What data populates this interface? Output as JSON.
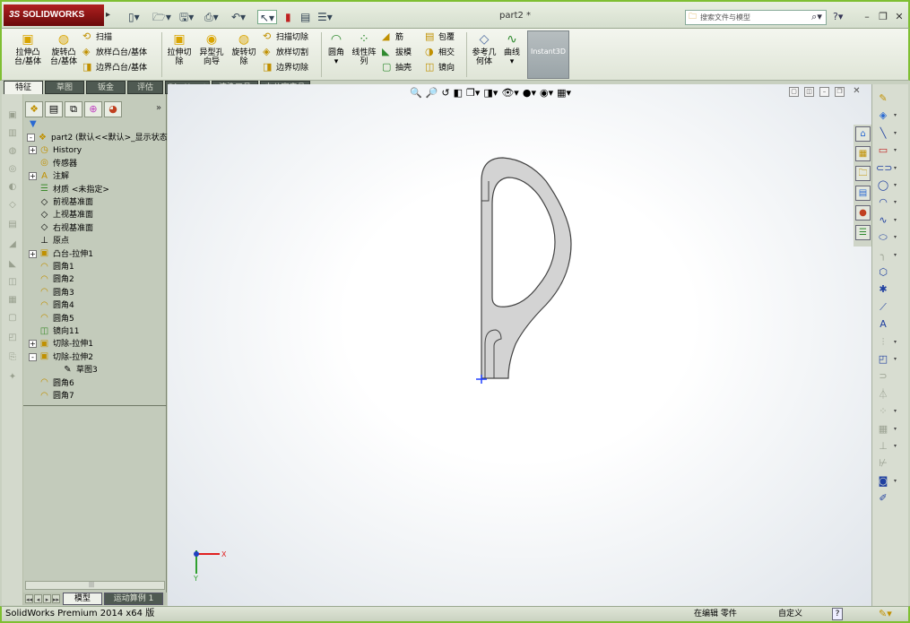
{
  "app": {
    "logo_prefix": "3S",
    "logo_text": "SOLIDWORKS",
    "document_title": "part2 *",
    "search_placeholder": "搜索文件与模型"
  },
  "quick_access": [
    {
      "icon": "new-document-icon",
      "glyph": "▯▾"
    },
    {
      "icon": "open-folder-icon",
      "glyph": "🗁▾"
    },
    {
      "icon": "save-icon",
      "glyph": "🖫▾"
    },
    {
      "icon": "print-icon",
      "glyph": "⎙▾"
    },
    {
      "icon": "undo-icon",
      "glyph": "↶▾"
    },
    {
      "icon": "select-cursor-icon",
      "glyph": "↖▾"
    },
    {
      "icon": "rebuild-icon",
      "glyph": "▮"
    },
    {
      "icon": "file-properties-icon",
      "glyph": "▤"
    },
    {
      "icon": "options-icon",
      "glyph": "☰▾"
    }
  ],
  "ribbon": {
    "big_buttons": [
      {
        "label_line1": "拉伸凸",
        "label_line2": "台/基体",
        "glyph": "▣",
        "color": "#d9a400"
      },
      {
        "label_line1": "旋转凸",
        "label_line2": "台/基体",
        "glyph": "◍",
        "color": "#d9a400"
      },
      {
        "label_line1": "拉伸切",
        "label_line2": "除",
        "glyph": "▣",
        "color": "#d9a400"
      },
      {
        "label_line1": "异型孔",
        "label_line2": "向导",
        "glyph": "◉",
        "color": "#d9a400"
      },
      {
        "label_line1": "旋转切",
        "label_line2": "除",
        "glyph": "◍",
        "color": "#d9a400"
      },
      {
        "label_line1": "圆角",
        "label_line2": "",
        "glyph": "◠",
        "color": "#2f8a2f"
      },
      {
        "label_line1": "线性阵",
        "label_line2": "列",
        "glyph": "⁘",
        "color": "#2f8a2f"
      },
      {
        "label_line1": "参考几",
        "label_line2": "何体",
        "glyph": "◇",
        "color": "#4c6aa0"
      },
      {
        "label_line1": "曲线",
        "label_line2": "",
        "glyph": "∿",
        "color": "#2f8a2f"
      }
    ],
    "small_buttons": [
      {
        "label": "扫描",
        "glyph": "⟲",
        "color": "#c09000"
      },
      {
        "label": "放样凸台/基体",
        "glyph": "◈",
        "color": "#c09000"
      },
      {
        "label": "边界凸台/基体",
        "glyph": "◨",
        "color": "#c09000"
      },
      {
        "label": "扫描切除",
        "glyph": "⟲",
        "color": "#c09000"
      },
      {
        "label": "放样切割",
        "glyph": "◈",
        "color": "#c09000"
      },
      {
        "label": "边界切除",
        "glyph": "◨",
        "color": "#c09000"
      },
      {
        "label": "筋",
        "glyph": "◢",
        "color": "#c09000"
      },
      {
        "label": "拔模",
        "glyph": "◣",
        "color": "#2f8a2f"
      },
      {
        "label": "抽壳",
        "glyph": "▢",
        "color": "#2f8a2f"
      },
      {
        "label": "包覆",
        "glyph": "▤",
        "color": "#c09000"
      },
      {
        "label": "相交",
        "glyph": "◑",
        "color": "#c09000"
      },
      {
        "label": "镜向",
        "glyph": "◫",
        "color": "#c09000"
      }
    ],
    "instant3d_label": "Instant3D"
  },
  "tabs": [
    "特征",
    "草图",
    "钣金",
    "评估",
    "DimXpert",
    "渲染工具",
    "办公室产品"
  ],
  "feature_manager": {
    "tab_icons": [
      {
        "name": "feature-tree-tab-icon",
        "glyph": "❖"
      },
      {
        "name": "property-manager-tab-icon",
        "glyph": "▤"
      },
      {
        "name": "configuration-manager-tab-icon",
        "glyph": "⧉"
      },
      {
        "name": "dimxpert-manager-tab-icon",
        "glyph": "⊕"
      },
      {
        "name": "display-manager-tab-icon",
        "glyph": "◕"
      }
    ],
    "collapse_glyph": "»",
    "filter_glyph": "▼",
    "tree": [
      {
        "label": "part2 (默认<<默认>_显示状态",
        "indent": 0,
        "expander": "-",
        "glyph": "❖",
        "tone": "yel"
      },
      {
        "label": "History",
        "indent": 1,
        "expander": "+",
        "glyph": "◷",
        "tone": "yel"
      },
      {
        "label": "传感器",
        "indent": 1,
        "expander": "",
        "glyph": "◎",
        "tone": "yel"
      },
      {
        "label": "注解",
        "indent": 1,
        "expander": "+",
        "glyph": "A",
        "tone": "yel"
      },
      {
        "label": "材质 <未指定>",
        "indent": 1,
        "expander": "",
        "glyph": "☰",
        "tone": "grn"
      },
      {
        "label": "前视基准面",
        "indent": 1,
        "expander": "",
        "glyph": "◇",
        "tone": ""
      },
      {
        "label": "上视基准面",
        "indent": 1,
        "expander": "",
        "glyph": "◇",
        "tone": ""
      },
      {
        "label": "右视基准面",
        "indent": 1,
        "expander": "",
        "glyph": "◇",
        "tone": ""
      },
      {
        "label": "原点",
        "indent": 1,
        "expander": "",
        "glyph": "⊥",
        "tone": ""
      },
      {
        "label": "凸台-拉伸1",
        "indent": 1,
        "expander": "+",
        "glyph": "▣",
        "tone": "yel"
      },
      {
        "label": "圆角1",
        "indent": 1,
        "expander": "",
        "glyph": "◠",
        "tone": "yel"
      },
      {
        "label": "圆角2",
        "indent": 1,
        "expander": "",
        "glyph": "◠",
        "tone": "yel"
      },
      {
        "label": "圆角3",
        "indent": 1,
        "expander": "",
        "glyph": "◠",
        "tone": "yel"
      },
      {
        "label": "圆角4",
        "indent": 1,
        "expander": "",
        "glyph": "◠",
        "tone": "yel"
      },
      {
        "label": "圆角5",
        "indent": 1,
        "expander": "",
        "glyph": "◠",
        "tone": "yel"
      },
      {
        "label": "镜向11",
        "indent": 1,
        "expander": "",
        "glyph": "◫",
        "tone": "grn"
      },
      {
        "label": "切除-拉伸1",
        "indent": 1,
        "expander": "+",
        "glyph": "▣",
        "tone": "yel"
      },
      {
        "label": "切除-拉伸2",
        "indent": 1,
        "expander": "-",
        "glyph": "▣",
        "tone": "yel"
      },
      {
        "label": "草图3",
        "indent": 2,
        "expander": "",
        "glyph": "✎",
        "tone": ""
      },
      {
        "label": "圆角6",
        "indent": 1,
        "expander": "",
        "glyph": "◠",
        "tone": "yel"
      },
      {
        "label": "圆角7",
        "indent": 1,
        "expander": "",
        "glyph": "◠",
        "tone": "yel"
      }
    ],
    "bottom_tabs": [
      "模型",
      "运动算例 1"
    ],
    "hscroll_glyph": "|||"
  },
  "graphics": {
    "hud_icons": [
      {
        "name": "zoom-to-fit-icon",
        "glyph": "🔍"
      },
      {
        "name": "zoom-area-icon",
        "glyph": "🔎"
      },
      {
        "name": "previous-view-icon",
        "glyph": "↺"
      },
      {
        "name": "section-view-icon",
        "glyph": "◧"
      },
      {
        "name": "view-orientation-icon",
        "glyph": "❒▾"
      },
      {
        "name": "display-style-icon",
        "glyph": "◨▾"
      },
      {
        "name": "hide-show-items-icon",
        "glyph": "👁▾"
      },
      {
        "name": "edit-appearance-icon",
        "glyph": "●▾"
      },
      {
        "name": "apply-scene-icon",
        "glyph": "◉▾"
      },
      {
        "name": "view-settings-icon",
        "glyph": "▦▾"
      }
    ],
    "triad_labels": {
      "x": "X",
      "y": "Y"
    }
  },
  "task_pane": [
    {
      "name": "solidworks-resources-icon",
      "glyph": "⌂"
    },
    {
      "name": "design-library-icon",
      "glyph": "▦"
    },
    {
      "name": "file-explorer-icon",
      "glyph": "🗀"
    },
    {
      "name": "view-palette-icon",
      "glyph": "▤"
    },
    {
      "name": "appearances-scenes-icon",
      "glyph": "●"
    },
    {
      "name": "custom-properties-icon",
      "glyph": "☰"
    }
  ],
  "right_toolbar": [
    {
      "name": "exit-sketch-icon",
      "glyph": "✎",
      "dim": false,
      "arrow": false
    },
    {
      "name": "smart-dimension-icon",
      "glyph": "◈",
      "dim": false,
      "arrow": true
    },
    {
      "name": "line-tool-icon",
      "glyph": "╲",
      "dim": false,
      "arrow": true
    },
    {
      "name": "rectangle-tool-icon",
      "glyph": "▭",
      "dim": false,
      "arrow": true
    },
    {
      "name": "slot-tool-icon",
      "glyph": "⊂⊃",
      "dim": false,
      "arrow": true
    },
    {
      "name": "circle-tool-icon",
      "glyph": "◯",
      "dim": false,
      "arrow": true
    },
    {
      "name": "arc-tool-icon",
      "glyph": "◠",
      "dim": false,
      "arrow": true
    },
    {
      "name": "spline-tool-icon",
      "glyph": "∿",
      "dim": false,
      "arrow": true
    },
    {
      "name": "ellipse-tool-icon",
      "glyph": "⬭",
      "dim": false,
      "arrow": true
    },
    {
      "name": "fillet-sketch-icon",
      "glyph": "╮",
      "dim": true,
      "arrow": true
    },
    {
      "name": "polygon-tool-icon",
      "glyph": "⬡",
      "dim": false,
      "arrow": false
    },
    {
      "name": "point-tool-icon",
      "glyph": "✱",
      "dim": false,
      "arrow": false
    },
    {
      "name": "plane-tool-icon",
      "glyph": "⟋",
      "dim": false,
      "arrow": false
    },
    {
      "name": "text-tool-icon",
      "glyph": "A",
      "dim": false,
      "arrow": false
    },
    {
      "name": "trim-entities-icon",
      "glyph": "⫶",
      "dim": true,
      "arrow": true
    },
    {
      "name": "convert-entities-icon",
      "glyph": "◰",
      "dim": false,
      "arrow": true
    },
    {
      "name": "offset-entities-icon",
      "glyph": "⊃",
      "dim": true,
      "arrow": false
    },
    {
      "name": "mirror-entities-icon",
      "glyph": "⏃",
      "dim": true,
      "arrow": false
    },
    {
      "name": "linear-pattern-icon",
      "glyph": "⁘",
      "dim": true,
      "arrow": true
    },
    {
      "name": "move-entities-icon",
      "glyph": "▦",
      "dim": true,
      "arrow": true
    },
    {
      "name": "display-relations-icon",
      "glyph": "⊥",
      "dim": true,
      "arrow": true
    },
    {
      "name": "repair-sketch-icon",
      "glyph": "⊬",
      "dim": true,
      "arrow": false
    },
    {
      "name": "quick-snaps-icon",
      "glyph": "◙",
      "dim": false,
      "arrow": true
    },
    {
      "name": "rapid-sketch-icon",
      "glyph": "✐",
      "dim": false,
      "arrow": false
    }
  ],
  "status": {
    "product": "SolidWorks Premium 2014 x64 版",
    "editing": "在编辑 零件",
    "units": "自定义",
    "help": "?"
  }
}
